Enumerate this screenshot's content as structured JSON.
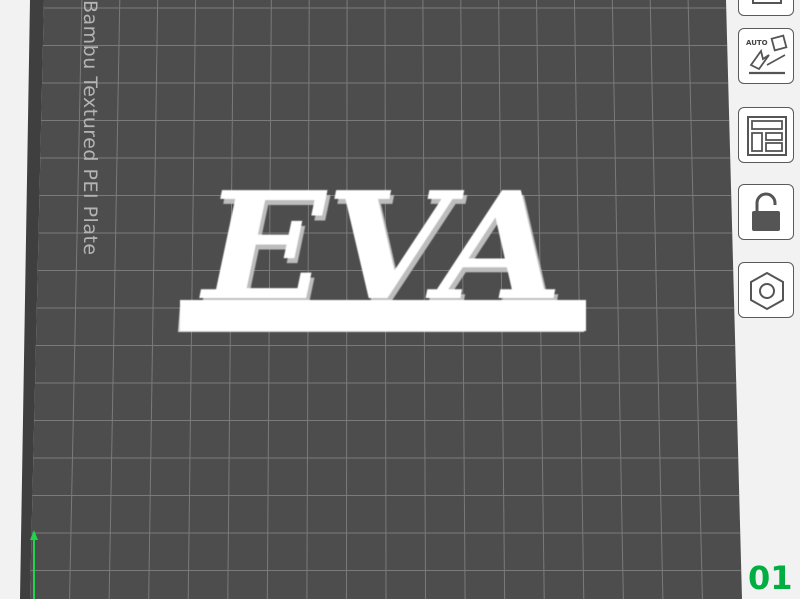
{
  "viewport": {
    "bed_label": "Bambu Textured PEI Plate",
    "model_text": "EVA",
    "colors": {
      "background": "#f2f2f2",
      "bed": "#4d4d4d",
      "grid_line": "#888888",
      "model": "#ffffff",
      "y_axis": "#1fd34a"
    }
  },
  "right_toolbar": {
    "buttons": [
      {
        "name": "view-cube-button",
        "icon": "cube-icon"
      },
      {
        "name": "auto-orient-button",
        "icon": "auto-orient-icon",
        "badge": "AUTO"
      },
      {
        "name": "arrange-button",
        "icon": "arrange-icon"
      },
      {
        "name": "lock-button",
        "icon": "unlock-icon"
      },
      {
        "name": "settings-button",
        "icon": "hex-nut-icon"
      }
    ]
  },
  "plate": {
    "number": "01",
    "accent": "#00ae42"
  }
}
